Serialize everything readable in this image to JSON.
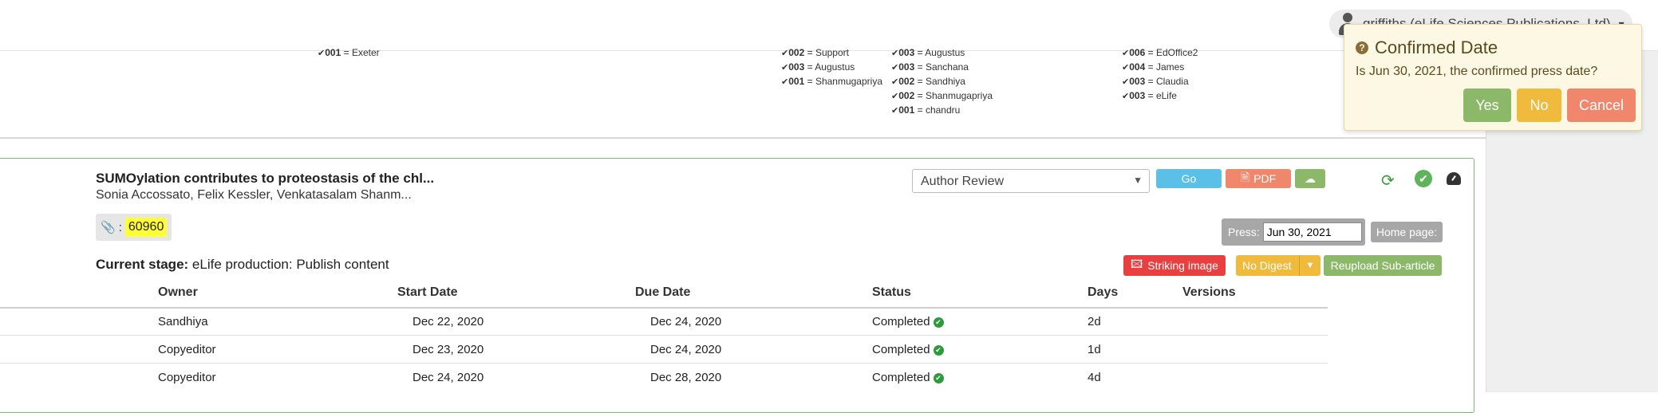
{
  "user": {
    "name": "griffiths (eLife Sciences Publications, Ltd)",
    "caret": "▾"
  },
  "stats": {
    "col1": [
      {
        "code": "001",
        "name": "Exeter"
      }
    ],
    "col2": [
      {
        "code": "002",
        "name": "Support"
      },
      {
        "code": "003",
        "name": "Augustus"
      },
      {
        "code": "001",
        "name": "Shanmugapriya"
      }
    ],
    "col3": [
      {
        "code": "003",
        "name": "Augustus"
      },
      {
        "code": "003",
        "name": "Sanchana"
      },
      {
        "code": "002",
        "name": "Sandhiya"
      },
      {
        "code": "002",
        "name": "Shanmugapriya"
      },
      {
        "code": "001",
        "name": "chandru"
      }
    ],
    "col4": [
      {
        "code": "006",
        "name": "EdOffice2"
      },
      {
        "code": "004",
        "name": "James"
      },
      {
        "code": "003",
        "name": "Claudia"
      },
      {
        "code": "003",
        "name": "eLife"
      }
    ]
  },
  "article": {
    "title": "SUMOylation contributes to proteostasis of the chl...",
    "authors": "Sonia Accossato, Felix Kessler, Venkatasalam Shanm...",
    "id_sep": ":",
    "id": "60960",
    "stage_label": "Current stage:",
    "stage_value": " eLife production: Publish content"
  },
  "toolbar": {
    "stage_select": "Author Review",
    "go": "Go",
    "pdf": "PDF",
    "press_label": "Press:",
    "press_value": "Jun 30, 2021",
    "homepage": "Home page:",
    "striking": "Striking image",
    "nodigest": "No Digest",
    "reupload": "Reupload Sub-article"
  },
  "table": {
    "headers": [
      "Owner",
      "Start Date",
      "Due Date",
      "Status",
      "Days",
      "Versions"
    ],
    "rows": [
      {
        "owner": "Sandhiya",
        "start": "Dec 22, 2020",
        "due": "Dec 24, 2020",
        "status": "Completed",
        "days": "2d"
      },
      {
        "owner": "Copyeditor",
        "start": "Dec 23, 2020",
        "due": "Dec 24, 2020",
        "status": "Completed",
        "days": "1d"
      },
      {
        "owner": "Copyeditor",
        "start": "Dec 24, 2020",
        "due": "Dec 28, 2020",
        "status": "Completed",
        "days": "4d"
      }
    ]
  },
  "popup": {
    "title": "Confirmed Date",
    "message": "Is Jun 30, 2021, the confirmed press date?",
    "yes": "Yes",
    "no": "No",
    "cancel": "Cancel"
  },
  "colors": {
    "accent_green": "#8cb86a",
    "go_blue": "#5bc0e8",
    "pdf_orange": "#f0866b",
    "warning_yellow": "#f0ba3c",
    "danger_red": "#e84040"
  }
}
